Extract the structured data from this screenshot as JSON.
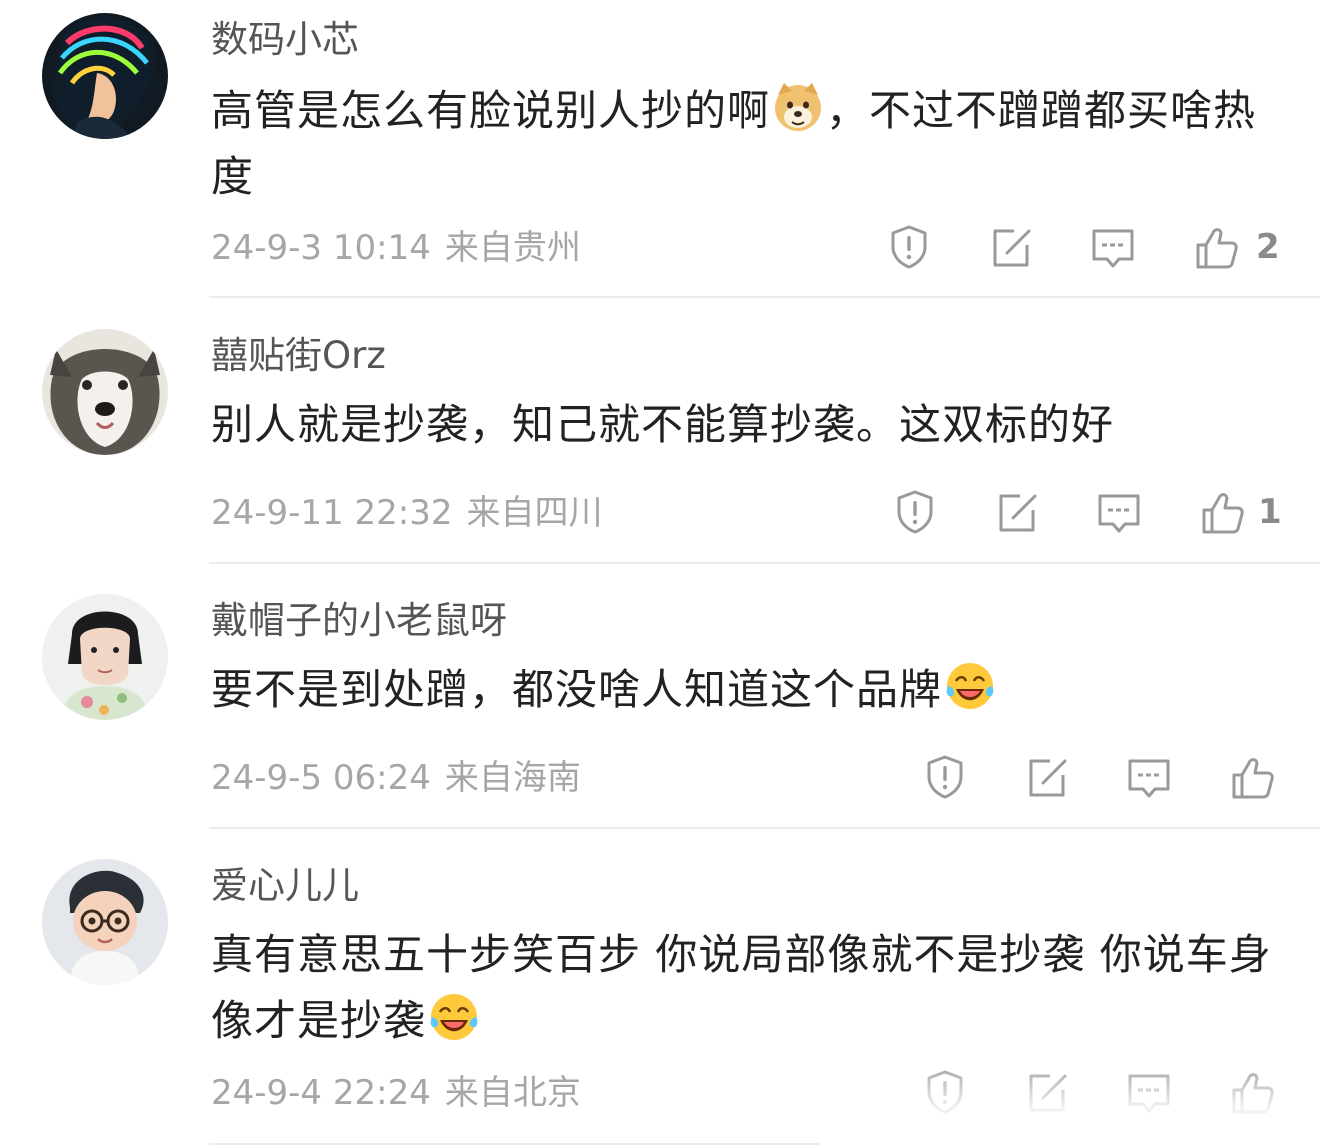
{
  "comments": [
    {
      "username": "数码小芯",
      "text_a": "高管是怎么有脸说别人抄的啊",
      "emoji": "doge-emoji",
      "text_b": "，不过不蹭蹭都买啥热度",
      "date": "24-9-3 10:14",
      "location": "来自贵州",
      "likes": "2"
    },
    {
      "username": "囍贴街Orz",
      "text_a": "别人就是抄袭，知己就不能算抄袭。这双标的好",
      "emoji": "",
      "text_b": "",
      "date": "24-9-11 22:32",
      "location": "来自四川",
      "likes": "1"
    },
    {
      "username": "戴帽子的小老鼠呀",
      "text_a": "要不是到处蹭，都没啥人知道这个品牌",
      "emoji": "laugh-cry-emoji",
      "text_b": "",
      "date": "24-9-5 06:24",
      "location": "来自海南",
      "likes": ""
    },
    {
      "username": "爱心儿儿",
      "text_a": "真有意思五十步笑百步  你说局部像就不是抄袭  你说车身像才是抄袭",
      "emoji": "laugh-cry-emoji",
      "text_b": "",
      "date": "24-9-4 22:24",
      "location": "来自北京",
      "likes": ""
    }
  ],
  "icons": {
    "report": "report-icon",
    "repost": "repost-icon",
    "reply": "reply-icon",
    "like": "thumbs-up-icon"
  },
  "colors": {
    "username": "#555555",
    "text": "#222222",
    "meta": "#a6a6a6",
    "icon": "#999999",
    "divider": "#ececec"
  }
}
